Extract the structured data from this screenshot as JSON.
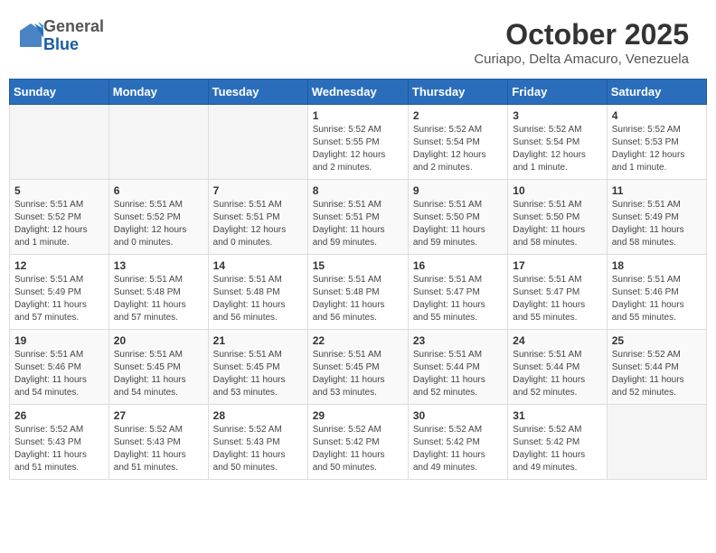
{
  "header": {
    "logo_general": "General",
    "logo_blue": "Blue",
    "title": "October 2025",
    "subtitle": "Curiapo, Delta Amacuro, Venezuela"
  },
  "days_of_week": [
    "Sunday",
    "Monday",
    "Tuesday",
    "Wednesday",
    "Thursday",
    "Friday",
    "Saturday"
  ],
  "weeks": [
    [
      {
        "day": "",
        "info": ""
      },
      {
        "day": "",
        "info": ""
      },
      {
        "day": "",
        "info": ""
      },
      {
        "day": "1",
        "info": "Sunrise: 5:52 AM\nSunset: 5:55 PM\nDaylight: 12 hours\nand 2 minutes."
      },
      {
        "day": "2",
        "info": "Sunrise: 5:52 AM\nSunset: 5:54 PM\nDaylight: 12 hours\nand 2 minutes."
      },
      {
        "day": "3",
        "info": "Sunrise: 5:52 AM\nSunset: 5:54 PM\nDaylight: 12 hours\nand 1 minute."
      },
      {
        "day": "4",
        "info": "Sunrise: 5:52 AM\nSunset: 5:53 PM\nDaylight: 12 hours\nand 1 minute."
      }
    ],
    [
      {
        "day": "5",
        "info": "Sunrise: 5:51 AM\nSunset: 5:52 PM\nDaylight: 12 hours\nand 1 minute."
      },
      {
        "day": "6",
        "info": "Sunrise: 5:51 AM\nSunset: 5:52 PM\nDaylight: 12 hours\nand 0 minutes."
      },
      {
        "day": "7",
        "info": "Sunrise: 5:51 AM\nSunset: 5:51 PM\nDaylight: 12 hours\nand 0 minutes."
      },
      {
        "day": "8",
        "info": "Sunrise: 5:51 AM\nSunset: 5:51 PM\nDaylight: 11 hours\nand 59 minutes."
      },
      {
        "day": "9",
        "info": "Sunrise: 5:51 AM\nSunset: 5:50 PM\nDaylight: 11 hours\nand 59 minutes."
      },
      {
        "day": "10",
        "info": "Sunrise: 5:51 AM\nSunset: 5:50 PM\nDaylight: 11 hours\nand 58 minutes."
      },
      {
        "day": "11",
        "info": "Sunrise: 5:51 AM\nSunset: 5:49 PM\nDaylight: 11 hours\nand 58 minutes."
      }
    ],
    [
      {
        "day": "12",
        "info": "Sunrise: 5:51 AM\nSunset: 5:49 PM\nDaylight: 11 hours\nand 57 minutes."
      },
      {
        "day": "13",
        "info": "Sunrise: 5:51 AM\nSunset: 5:48 PM\nDaylight: 11 hours\nand 57 minutes."
      },
      {
        "day": "14",
        "info": "Sunrise: 5:51 AM\nSunset: 5:48 PM\nDaylight: 11 hours\nand 56 minutes."
      },
      {
        "day": "15",
        "info": "Sunrise: 5:51 AM\nSunset: 5:48 PM\nDaylight: 11 hours\nand 56 minutes."
      },
      {
        "day": "16",
        "info": "Sunrise: 5:51 AM\nSunset: 5:47 PM\nDaylight: 11 hours\nand 55 minutes."
      },
      {
        "day": "17",
        "info": "Sunrise: 5:51 AM\nSunset: 5:47 PM\nDaylight: 11 hours\nand 55 minutes."
      },
      {
        "day": "18",
        "info": "Sunrise: 5:51 AM\nSunset: 5:46 PM\nDaylight: 11 hours\nand 55 minutes."
      }
    ],
    [
      {
        "day": "19",
        "info": "Sunrise: 5:51 AM\nSunset: 5:46 PM\nDaylight: 11 hours\nand 54 minutes."
      },
      {
        "day": "20",
        "info": "Sunrise: 5:51 AM\nSunset: 5:45 PM\nDaylight: 11 hours\nand 54 minutes."
      },
      {
        "day": "21",
        "info": "Sunrise: 5:51 AM\nSunset: 5:45 PM\nDaylight: 11 hours\nand 53 minutes."
      },
      {
        "day": "22",
        "info": "Sunrise: 5:51 AM\nSunset: 5:45 PM\nDaylight: 11 hours\nand 53 minutes."
      },
      {
        "day": "23",
        "info": "Sunrise: 5:51 AM\nSunset: 5:44 PM\nDaylight: 11 hours\nand 52 minutes."
      },
      {
        "day": "24",
        "info": "Sunrise: 5:51 AM\nSunset: 5:44 PM\nDaylight: 11 hours\nand 52 minutes."
      },
      {
        "day": "25",
        "info": "Sunrise: 5:52 AM\nSunset: 5:44 PM\nDaylight: 11 hours\nand 52 minutes."
      }
    ],
    [
      {
        "day": "26",
        "info": "Sunrise: 5:52 AM\nSunset: 5:43 PM\nDaylight: 11 hours\nand 51 minutes."
      },
      {
        "day": "27",
        "info": "Sunrise: 5:52 AM\nSunset: 5:43 PM\nDaylight: 11 hours\nand 51 minutes."
      },
      {
        "day": "28",
        "info": "Sunrise: 5:52 AM\nSunset: 5:43 PM\nDaylight: 11 hours\nand 50 minutes."
      },
      {
        "day": "29",
        "info": "Sunrise: 5:52 AM\nSunset: 5:42 PM\nDaylight: 11 hours\nand 50 minutes."
      },
      {
        "day": "30",
        "info": "Sunrise: 5:52 AM\nSunset: 5:42 PM\nDaylight: 11 hours\nand 49 minutes."
      },
      {
        "day": "31",
        "info": "Sunrise: 5:52 AM\nSunset: 5:42 PM\nDaylight: 11 hours\nand 49 minutes."
      },
      {
        "day": "",
        "info": ""
      }
    ]
  ]
}
